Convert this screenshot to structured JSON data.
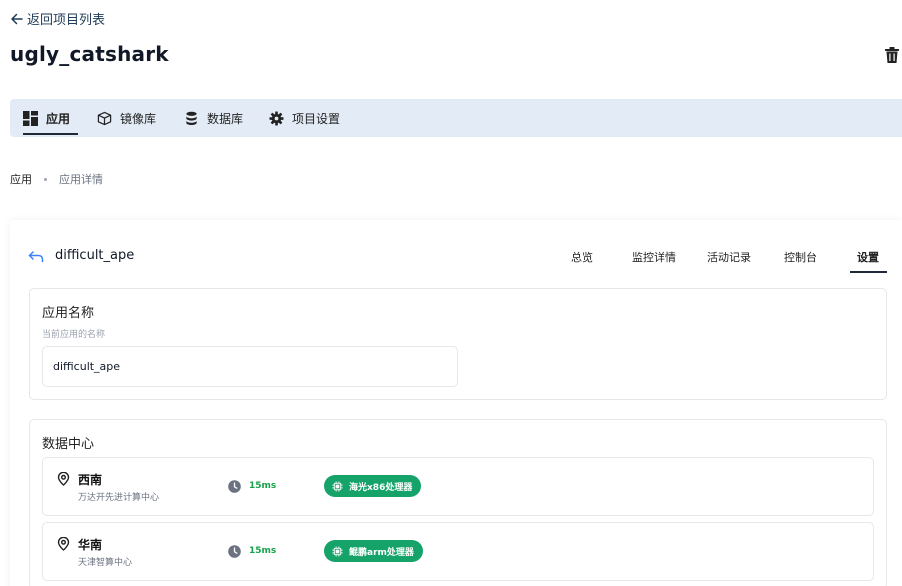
{
  "header": {
    "back_label": "返回项目列表",
    "project_name": "ugly_catshark"
  },
  "nav": {
    "tabs": [
      {
        "label": "应用",
        "icon": "grid-icon",
        "active": true
      },
      {
        "label": "镜像库",
        "icon": "box-icon",
        "active": false
      },
      {
        "label": "数据库",
        "icon": "database-icon",
        "active": false
      },
      {
        "label": "项目设置",
        "icon": "gear-icon",
        "active": false
      }
    ]
  },
  "breadcrumb": {
    "root": "应用",
    "current": "应用详情"
  },
  "app": {
    "name": "difficult_ape",
    "tabs": [
      {
        "label": "总览",
        "active": false
      },
      {
        "label": "监控详情",
        "active": false
      },
      {
        "label": "活动记录",
        "active": false
      },
      {
        "label": "控制台",
        "active": false
      },
      {
        "label": "设置",
        "active": true
      }
    ]
  },
  "name_section": {
    "title": "应用名称",
    "subtitle": "当前应用的名称",
    "value": "difficult_ape"
  },
  "datacenter_section": {
    "title": "数据中心",
    "items": [
      {
        "name": "西南",
        "desc": "万达开先进计算中心",
        "latency": "15ms",
        "processor": "海光x86处理器"
      },
      {
        "name": "华南",
        "desc": "天津智算中心",
        "latency": "15ms",
        "processor": "鲲鹏arm处理器"
      }
    ]
  },
  "colors": {
    "nav_bg": "#e3ecf6",
    "accent_green": "#16a36a",
    "latency_green": "#16a34a",
    "back_arrow_blue": "#3b82f6"
  }
}
